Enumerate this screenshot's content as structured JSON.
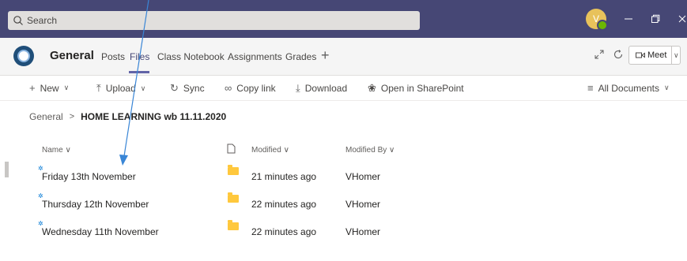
{
  "search": {
    "placeholder": "Search"
  },
  "user": {
    "initial": "V"
  },
  "channel": {
    "title": "General",
    "tabs": [
      {
        "label": "Posts"
      },
      {
        "label": "Files"
      },
      {
        "label": "Class Notebook"
      },
      {
        "label": "Assignments"
      },
      {
        "label": "Grades"
      }
    ],
    "add_tab": "+",
    "meet_label": "Meet"
  },
  "toolbar": {
    "new": "New",
    "upload": "Upload",
    "sync": "Sync",
    "copy_link": "Copy link",
    "download": "Download",
    "open_sharepoint": "Open in SharePoint",
    "view": "All Documents"
  },
  "breadcrumb": {
    "root": "General",
    "current": "HOME LEARNING wb 11.11.2020"
  },
  "columns": {
    "name": "Name",
    "modified": "Modified",
    "modified_by": "Modified By"
  },
  "files": [
    {
      "name": "Friday 13th November",
      "modified": "21 minutes ago",
      "modified_by": "VHomer"
    },
    {
      "name": "Thursday 12th November",
      "modified": "22 minutes ago",
      "modified_by": "VHomer"
    },
    {
      "name": "Wednesday 11th November",
      "modified": "22 minutes ago",
      "modified_by": "VHomer"
    }
  ],
  "colors": {
    "title_bar": "#464775",
    "accent": "#6264a7",
    "folder": "#ffc83d",
    "annotation_arrow": "#3a86d6"
  }
}
